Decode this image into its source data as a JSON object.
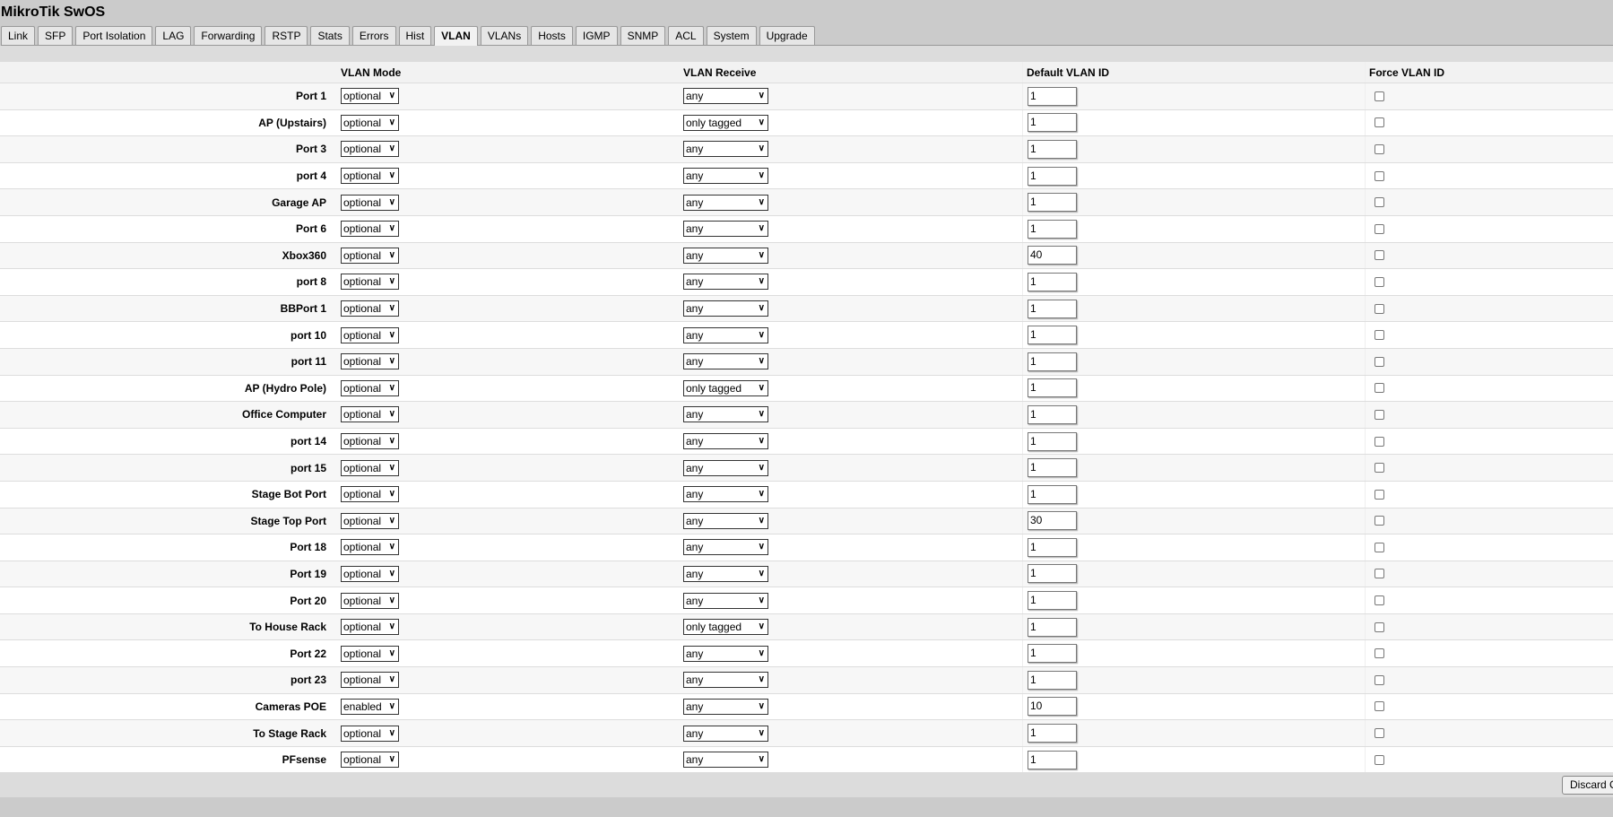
{
  "app": {
    "title": "MikroTik SwOS"
  },
  "tabs": [
    "Link",
    "SFP",
    "Port Isolation",
    "LAG",
    "Forwarding",
    "RSTP",
    "Stats",
    "Errors",
    "Hist",
    "VLAN",
    "VLANs",
    "Hosts",
    "IGMP",
    "SNMP",
    "ACL",
    "System",
    "Upgrade"
  ],
  "active_tab": "VLAN",
  "columns": {
    "mode": "VLAN Mode",
    "receive": "VLAN Receive",
    "vid": "Default VLAN ID",
    "force": "Force VLAN ID"
  },
  "rows": [
    {
      "name": "Port 1",
      "mode": "optional",
      "receive": "any",
      "vid": "1",
      "force": false
    },
    {
      "name": "AP (Upstairs)",
      "mode": "optional",
      "receive": "only tagged",
      "vid": "1",
      "force": false
    },
    {
      "name": "Port 3",
      "mode": "optional",
      "receive": "any",
      "vid": "1",
      "force": false
    },
    {
      "name": "port 4",
      "mode": "optional",
      "receive": "any",
      "vid": "1",
      "force": false
    },
    {
      "name": "Garage AP",
      "mode": "optional",
      "receive": "any",
      "vid": "1",
      "force": false
    },
    {
      "name": "Port 6",
      "mode": "optional",
      "receive": "any",
      "vid": "1",
      "force": false
    },
    {
      "name": "Xbox360",
      "mode": "optional",
      "receive": "any",
      "vid": "40",
      "force": false
    },
    {
      "name": "port 8",
      "mode": "optional",
      "receive": "any",
      "vid": "1",
      "force": false
    },
    {
      "name": "BBPort 1",
      "mode": "optional",
      "receive": "any",
      "vid": "1",
      "force": false
    },
    {
      "name": "port 10",
      "mode": "optional",
      "receive": "any",
      "vid": "1",
      "force": false
    },
    {
      "name": "port 11",
      "mode": "optional",
      "receive": "any",
      "vid": "1",
      "force": false
    },
    {
      "name": "AP (Hydro Pole)",
      "mode": "optional",
      "receive": "only tagged",
      "vid": "1",
      "force": false
    },
    {
      "name": "Office Computer",
      "mode": "optional",
      "receive": "any",
      "vid": "1",
      "force": false
    },
    {
      "name": "port 14",
      "mode": "optional",
      "receive": "any",
      "vid": "1",
      "force": false
    },
    {
      "name": "port 15",
      "mode": "optional",
      "receive": "any",
      "vid": "1",
      "force": false
    },
    {
      "name": "Stage Bot Port",
      "mode": "optional",
      "receive": "any",
      "vid": "1",
      "force": false
    },
    {
      "name": "Stage Top Port",
      "mode": "optional",
      "receive": "any",
      "vid": "30",
      "force": false
    },
    {
      "name": "Port 18",
      "mode": "optional",
      "receive": "any",
      "vid": "1",
      "force": false
    },
    {
      "name": "Port 19",
      "mode": "optional",
      "receive": "any",
      "vid": "1",
      "force": false
    },
    {
      "name": "Port 20",
      "mode": "optional",
      "receive": "any",
      "vid": "1",
      "force": false
    },
    {
      "name": "To House Rack",
      "mode": "optional",
      "receive": "only tagged",
      "vid": "1",
      "force": false
    },
    {
      "name": "Port 22",
      "mode": "optional",
      "receive": "any",
      "vid": "1",
      "force": false
    },
    {
      "name": "port 23",
      "mode": "optional",
      "receive": "any",
      "vid": "1",
      "force": false
    },
    {
      "name": "Cameras POE",
      "mode": "enabled",
      "receive": "any",
      "vid": "10",
      "force": false
    },
    {
      "name": "To Stage Rack",
      "mode": "optional",
      "receive": "any",
      "vid": "1",
      "force": false
    },
    {
      "name": "PFsense",
      "mode": "optional",
      "receive": "any",
      "vid": "1",
      "force": false
    }
  ],
  "footer": {
    "discard_label": "Discard C"
  }
}
